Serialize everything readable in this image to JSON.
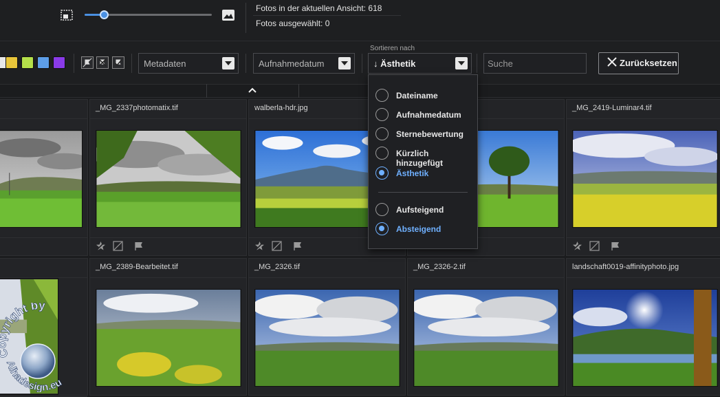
{
  "top": {
    "stats_in_view": "Fotos in der aktuellen Ansicht: 618",
    "stats_selected": "Fotos ausgewählt: 0",
    "thumb_slider_value": 0.15
  },
  "filter": {
    "color_labels": [
      "#e8c53a",
      "#b5e04a",
      "#5d9ee8",
      "#8a3be8"
    ],
    "metadata": "Metadaten",
    "date": "Aufnahmedatum",
    "sort_label": "Sortieren nach",
    "sort_value": "↓ Ästhetik",
    "search_placeholder": "Suche",
    "reset": "Zurücksetzen"
  },
  "sort_menu": {
    "fields": [
      {
        "label": "Dateiname",
        "selected": false
      },
      {
        "label": "Aufnahmedatum",
        "selected": false
      },
      {
        "label": "Sternebewertung",
        "selected": false
      },
      {
        "label": "Kürzlich hinzugefügt",
        "selected": false
      },
      {
        "label": "Ästhetik",
        "selected": true
      }
    ],
    "order": [
      {
        "label": "Aufsteigend",
        "selected": false
      },
      {
        "label": "Absteigend",
        "selected": true
      }
    ]
  },
  "grid": {
    "row1": [
      {
        "title": ""
      },
      {
        "title": "_MG_2337photomatix.tif"
      },
      {
        "title": "walberla-hdr.jpg"
      },
      {
        "title": ""
      },
      {
        "title": "_MG_2419-Luminar4.tif"
      }
    ],
    "row2": [
      {
        "title": ""
      },
      {
        "title": "_MG_2389-Bearbeitet.tif"
      },
      {
        "title": "_MG_2326.tif"
      },
      {
        "title": "_MG_2326-2.tif"
      },
      {
        "title": "landschaft0019-affinityphoto.jpg"
      }
    ]
  },
  "watermark": {
    "text_top": "Copyright by",
    "text_bottom": "Alhadesign.eu"
  }
}
